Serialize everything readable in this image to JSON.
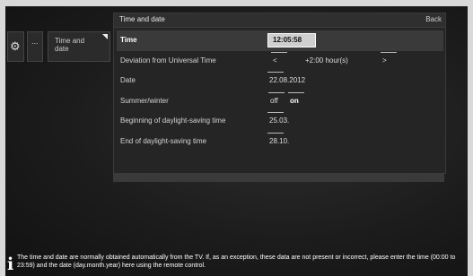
{
  "breadcrumb": {
    "gear_icon": "gear-icon",
    "dots": "...",
    "tv_label": "Time and date"
  },
  "panel": {
    "title": "Time and date",
    "back": "Back"
  },
  "rows": [
    {
      "label": "Time",
      "value": "12:05:58"
    },
    {
      "label": "Deviation from Universal Time",
      "prev": "<",
      "value": "+2:00 hour(s)",
      "next": ">"
    },
    {
      "label": "Date",
      "value": "22.08.2012"
    },
    {
      "label": "Summer/winter",
      "opt1": "off",
      "opt2": "on"
    },
    {
      "label": "Beginning of daylight-saving time",
      "value": "25.03."
    },
    {
      "label": "End of daylight-saving time",
      "value": "28.10."
    }
  ],
  "info": {
    "icon": "i",
    "text": "The time and date are normally obtained automatically from the TV. If, as an exception, these data are not present or incorrect, please enter the time (00:00 to 23:59) and the date (day.month.year) here using the remote control."
  }
}
